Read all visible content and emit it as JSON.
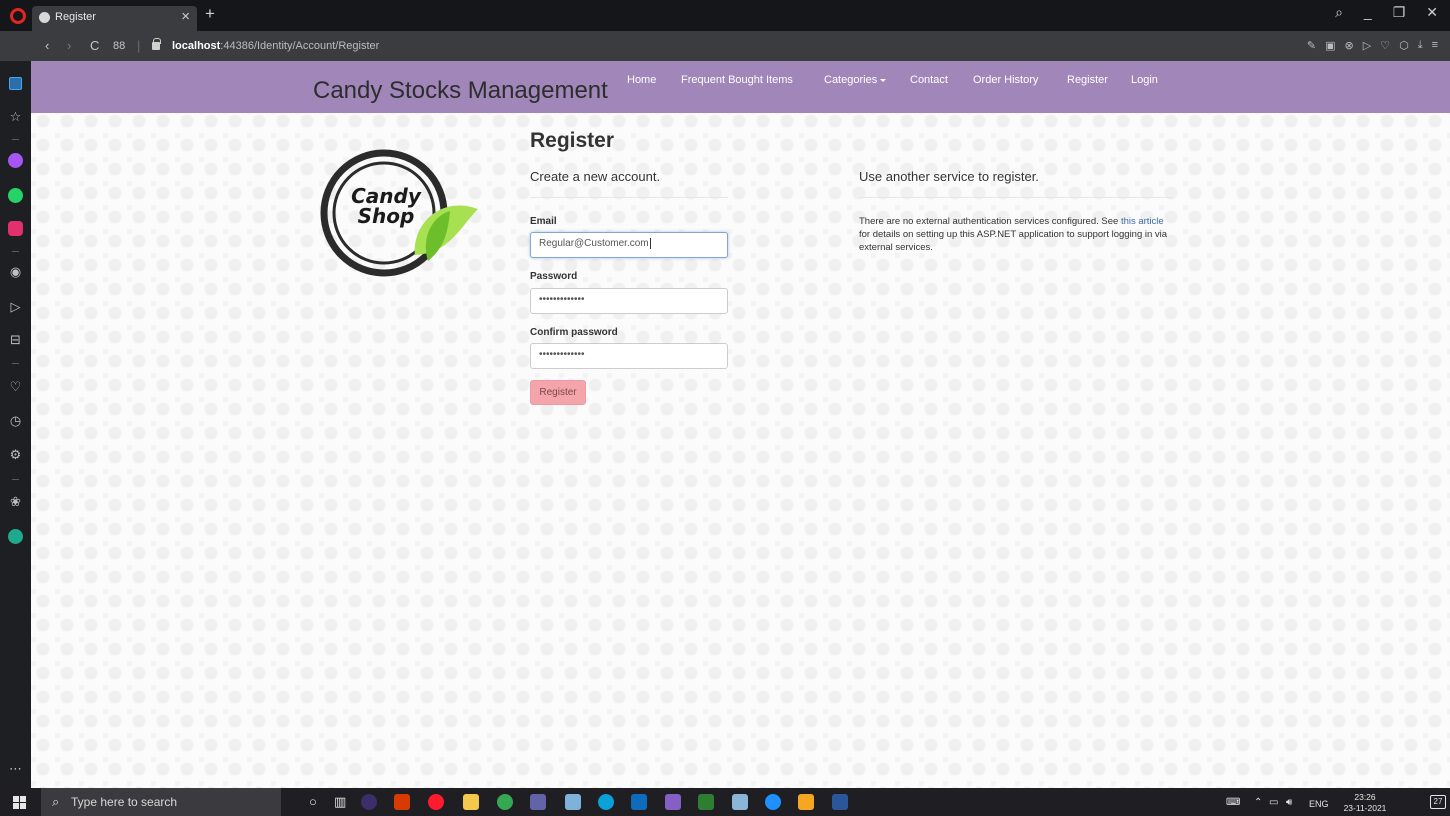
{
  "browser": {
    "tab_title": "Register",
    "tab_close": "×",
    "new_tab": "+",
    "url_host": "localhost",
    "url_path": ":44386/Identity/Account/Register",
    "back": "‹",
    "forward": "›",
    "reload": "C",
    "tabs_grid": "88",
    "window_controls": [
      "search-icon",
      "minimize-icon",
      "restore-icon",
      "close-icon"
    ],
    "toolbar_icons": [
      "edit-icon",
      "camera-icon",
      "shield-icon",
      "play-icon",
      "heart-icon",
      "cube-icon",
      "download-icon",
      "menu-icon"
    ]
  },
  "sidebar": {
    "items": [
      "home-icon",
      "bookmark-icon",
      "messenger-icon",
      "whatsapp-icon",
      "instagram-icon",
      "player-icon",
      "flow-icon",
      "tabs-icon",
      "heart-icon",
      "history-icon",
      "settings-icon",
      "tips-icon",
      "aria-icon",
      "more-icon"
    ]
  },
  "navbar": {
    "brand": "Candy Stocks Management",
    "links": [
      {
        "label": "Home"
      },
      {
        "label": "Frequent Bought Items"
      },
      {
        "label": "Categories"
      },
      {
        "label": "Contact"
      },
      {
        "label": "Order History"
      },
      {
        "label": "Register"
      },
      {
        "label": "Login"
      }
    ]
  },
  "logo": {
    "line1": "Candy",
    "line2": "Shop",
    "colors": {
      "ring": "#2b2b2b",
      "leaf_dark": "#6cbe2a",
      "leaf_light": "#a7e050"
    }
  },
  "form": {
    "heading": "Register",
    "subheading": "Create a new account.",
    "email_label": "Email",
    "email_value": "Regular@Customer.com",
    "password_label": "Password",
    "password_value": "•••••••••••••",
    "confirm_label": "Confirm password",
    "confirm_value": "•••••••••••••",
    "submit_label": "Register"
  },
  "external": {
    "heading": "Use another service to register.",
    "text_before": "There are no external authentication services configured. See ",
    "link_text": "this article",
    "text_after": " for details on setting up this ASP.NET application to support logging in via external services."
  },
  "taskbar": {
    "search_placeholder": "Type here to search",
    "apps": [
      "cortana-icon",
      "task-view-icon",
      "eclipse-icon",
      "office-icon",
      "opera-icon",
      "file-explorer-icon",
      "chrome-icon",
      "teams-icon",
      "onenote-icon",
      "edge-icon",
      "outlook-icon",
      "visual-studio-icon",
      "excel-icon",
      "paint-icon",
      "internet-explorer-icon",
      "paint3d-icon",
      "word-icon"
    ],
    "language": "ENG",
    "time": "23:26",
    "date": "23-11-2021",
    "notifications": "27"
  },
  "colors": {
    "navbar": "#a186b9",
    "register_button": "#f4a5ab",
    "link": "#3a6ea8"
  }
}
